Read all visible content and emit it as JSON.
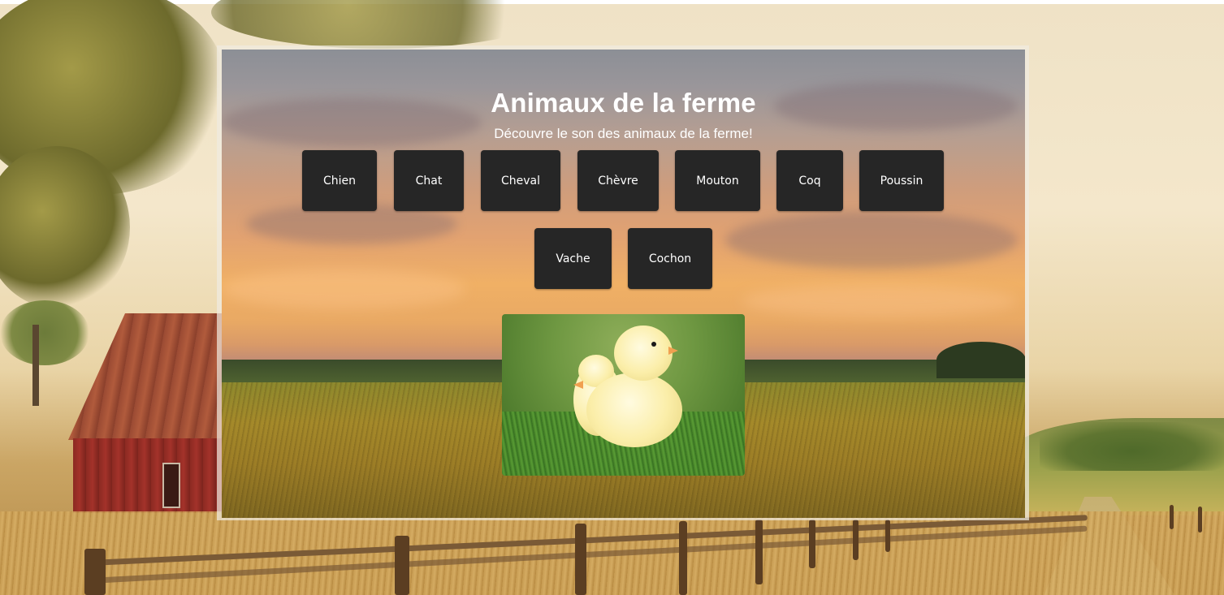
{
  "page": {
    "title": "Animaux de la ferme",
    "subtitle": "Découvre le son des animaux de la ferme!"
  },
  "animals": [
    {
      "label": "Chien"
    },
    {
      "label": "Chat"
    },
    {
      "label": "Cheval"
    },
    {
      "label": "Chèvre"
    },
    {
      "label": "Mouton"
    },
    {
      "label": "Coq"
    },
    {
      "label": "Poussin"
    },
    {
      "label": "Vache"
    },
    {
      "label": "Cochon"
    }
  ],
  "display_image": {
    "subject": "chick-image"
  },
  "colors": {
    "button_bg": "#262626",
    "button_text": "#ffffff",
    "title_text": "#ffffff"
  }
}
